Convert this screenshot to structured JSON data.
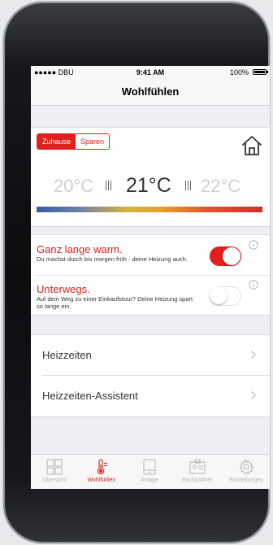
{
  "status_bar": {
    "carrier": "●●●●● DBU",
    "time": "9:41 AM",
    "battery": "100%",
    "battery_level": 1.0
  },
  "nav": {
    "title": "Wohlfühlen"
  },
  "mode_toggle": {
    "options": [
      "Zuhause",
      "Sparen"
    ],
    "selected": "Zuhause"
  },
  "temperature": {
    "lower": "20°C",
    "current": "21°C",
    "upper": "22°C"
  },
  "settings": [
    {
      "title": "Ganz lange warm.",
      "description": "Du machst durch bis morgen früh - deine Heizung auch.",
      "enabled": true
    },
    {
      "title": "Unterwegs.",
      "description": "Auf dem Weg zu einer Einkaufstour? Deine Heizung spart so lange ein.",
      "enabled": false
    }
  ],
  "menu": [
    {
      "label": "Heizzeiten"
    },
    {
      "label": "Heizzeiten-Assistent"
    }
  ],
  "tabs": [
    {
      "label": "Übersicht",
      "icon": "grid-icon",
      "active": false
    },
    {
      "label": "Wohlfühlen",
      "icon": "thermometer-icon",
      "active": true
    },
    {
      "label": "Anlage",
      "icon": "device-icon",
      "active": false
    },
    {
      "label": "Fachpartner",
      "icon": "id-card-icon",
      "active": false
    },
    {
      "label": "Einstellungen",
      "icon": "gear-icon",
      "active": false
    }
  ],
  "colors": {
    "accent": "#e1201e",
    "inactive": "#b5b5b5",
    "background": "#efeff4"
  }
}
